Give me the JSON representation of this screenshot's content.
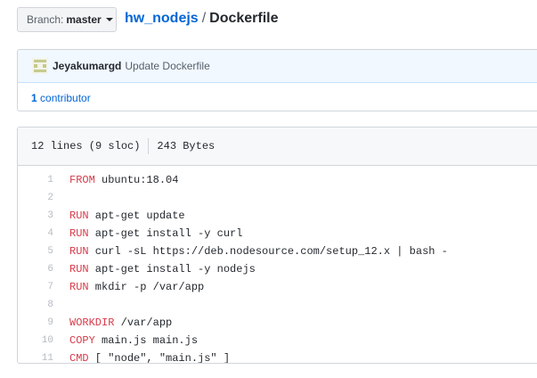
{
  "branch": {
    "label": "Branch:",
    "value": "master"
  },
  "breadcrumb": {
    "repo": "hw_nodejs",
    "separator": "/",
    "file": "Dockerfile"
  },
  "commit": {
    "author": "Jeyakumargd",
    "message": "Update Dockerfile"
  },
  "contributors": {
    "count": "1",
    "label": "contributor"
  },
  "file_info": {
    "lines": "12 lines (9 sloc)",
    "size": "243 Bytes"
  },
  "code": [
    {
      "n": "1",
      "kw": "FROM",
      "rest": " ubuntu:18.04"
    },
    {
      "n": "2",
      "kw": "",
      "rest": ""
    },
    {
      "n": "3",
      "kw": "RUN",
      "rest": " apt-get update"
    },
    {
      "n": "4",
      "kw": "RUN",
      "rest": " apt-get install -y curl"
    },
    {
      "n": "5",
      "kw": "RUN",
      "rest": " curl -sL https://deb.nodesource.com/setup_12.x | bash -"
    },
    {
      "n": "6",
      "kw": "RUN",
      "rest": " apt-get install -y nodejs"
    },
    {
      "n": "7",
      "kw": "RUN",
      "rest": " mkdir -p /var/app"
    },
    {
      "n": "8",
      "kw": "",
      "rest": ""
    },
    {
      "n": "9",
      "kw": "WORKDIR",
      "rest": " /var/app"
    },
    {
      "n": "10",
      "kw": "COPY",
      "rest": " main.js main.js"
    },
    {
      "n": "11",
      "kw": "CMD",
      "rest": " [ \"node\", \"main.js\" ]"
    }
  ]
}
